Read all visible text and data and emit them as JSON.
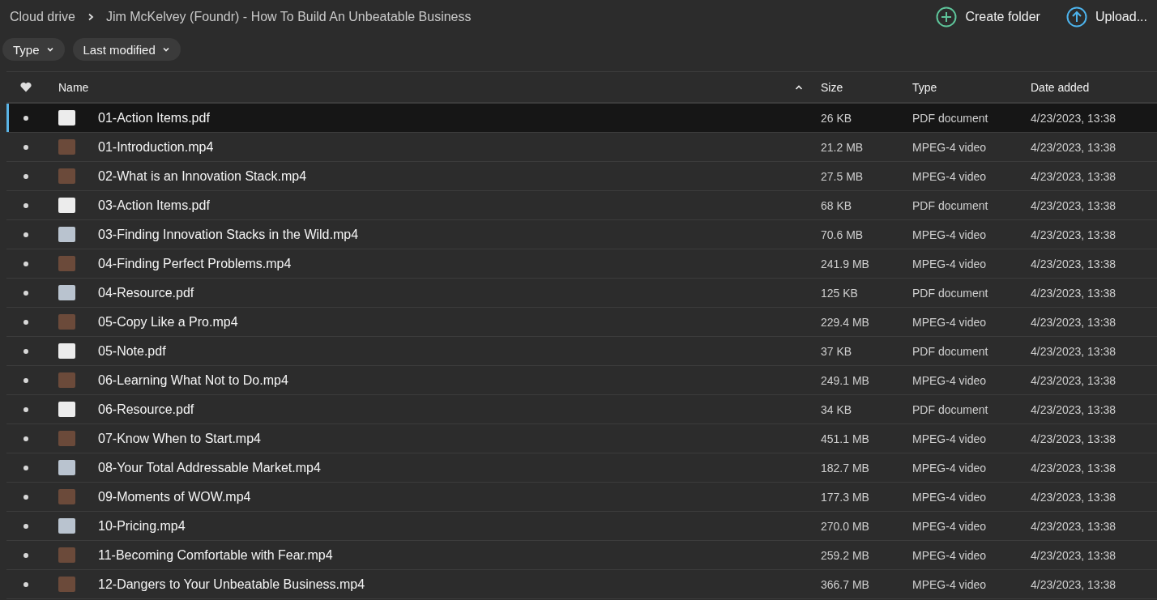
{
  "breadcrumb": [
    "Cloud drive",
    "Jim McKelvey (Foundr) - How To Build An Unbeatable Business"
  ],
  "actions": [
    "Create folder",
    "Upload..."
  ],
  "filters": [
    "Type",
    "Last modified"
  ],
  "columns": {
    "name": "Name",
    "size": "Size",
    "type": "Type",
    "date": "Date added"
  },
  "rows": [
    {
      "name": "01-Action Items.pdf",
      "size": "26 KB",
      "type": "PDF document",
      "date": "4/23/2023, 13:38",
      "kind": "pdf",
      "selected": true
    },
    {
      "name": "01-Introduction.mp4",
      "size": "21.2 MB",
      "type": "MPEG-4 video",
      "date": "4/23/2023, 13:38",
      "kind": "video",
      "selected": false
    },
    {
      "name": "02-What is an Innovation Stack.mp4",
      "size": "27.5 MB",
      "type": "MPEG-4 video",
      "date": "4/23/2023, 13:38",
      "kind": "video",
      "selected": false
    },
    {
      "name": "03-Action Items.pdf",
      "size": "68 KB",
      "type": "PDF document",
      "date": "4/23/2023, 13:38",
      "kind": "pdf",
      "selected": false
    },
    {
      "name": "03-Finding Innovation Stacks in the Wild.mp4",
      "size": "70.6 MB",
      "type": "MPEG-4 video",
      "date": "4/23/2023, 13:38",
      "kind": "slide",
      "selected": false
    },
    {
      "name": "04-Finding Perfect Problems.mp4",
      "size": "241.9 MB",
      "type": "MPEG-4 video",
      "date": "4/23/2023, 13:38",
      "kind": "video",
      "selected": false
    },
    {
      "name": "04-Resource.pdf",
      "size": "125 KB",
      "type": "PDF document",
      "date": "4/23/2023, 13:38",
      "kind": "slide",
      "selected": false
    },
    {
      "name": "05-Copy Like a Pro.mp4",
      "size": "229.4 MB",
      "type": "MPEG-4 video",
      "date": "4/23/2023, 13:38",
      "kind": "video",
      "selected": false
    },
    {
      "name": "05-Note.pdf",
      "size": "37 KB",
      "type": "PDF document",
      "date": "4/23/2023, 13:38",
      "kind": "pdf",
      "selected": false
    },
    {
      "name": "06-Learning What Not to Do.mp4",
      "size": "249.1 MB",
      "type": "MPEG-4 video",
      "date": "4/23/2023, 13:38",
      "kind": "video",
      "selected": false
    },
    {
      "name": "06-Resource.pdf",
      "size": "34 KB",
      "type": "PDF document",
      "date": "4/23/2023, 13:38",
      "kind": "pdf",
      "selected": false
    },
    {
      "name": "07-Know When to Start.mp4",
      "size": "451.1 MB",
      "type": "MPEG-4 video",
      "date": "4/23/2023, 13:38",
      "kind": "video",
      "selected": false
    },
    {
      "name": "08-Your Total Addressable Market.mp4",
      "size": "182.7 MB",
      "type": "MPEG-4 video",
      "date": "4/23/2023, 13:38",
      "kind": "slide",
      "selected": false
    },
    {
      "name": "09-Moments of WOW.mp4",
      "size": "177.3 MB",
      "type": "MPEG-4 video",
      "date": "4/23/2023, 13:38",
      "kind": "video",
      "selected": false
    },
    {
      "name": "10-Pricing.mp4",
      "size": "270.0 MB",
      "type": "MPEG-4 video",
      "date": "4/23/2023, 13:38",
      "kind": "slide",
      "selected": false
    },
    {
      "name": "11-Becoming Comfortable with Fear.mp4",
      "size": "259.2 MB",
      "type": "MPEG-4 video",
      "date": "4/23/2023, 13:38",
      "kind": "video",
      "selected": false
    },
    {
      "name": "12-Dangers to Your Unbeatable Business.mp4",
      "size": "366.7 MB",
      "type": "MPEG-4 video",
      "date": "4/23/2023, 13:38",
      "kind": "video",
      "selected": false
    }
  ]
}
